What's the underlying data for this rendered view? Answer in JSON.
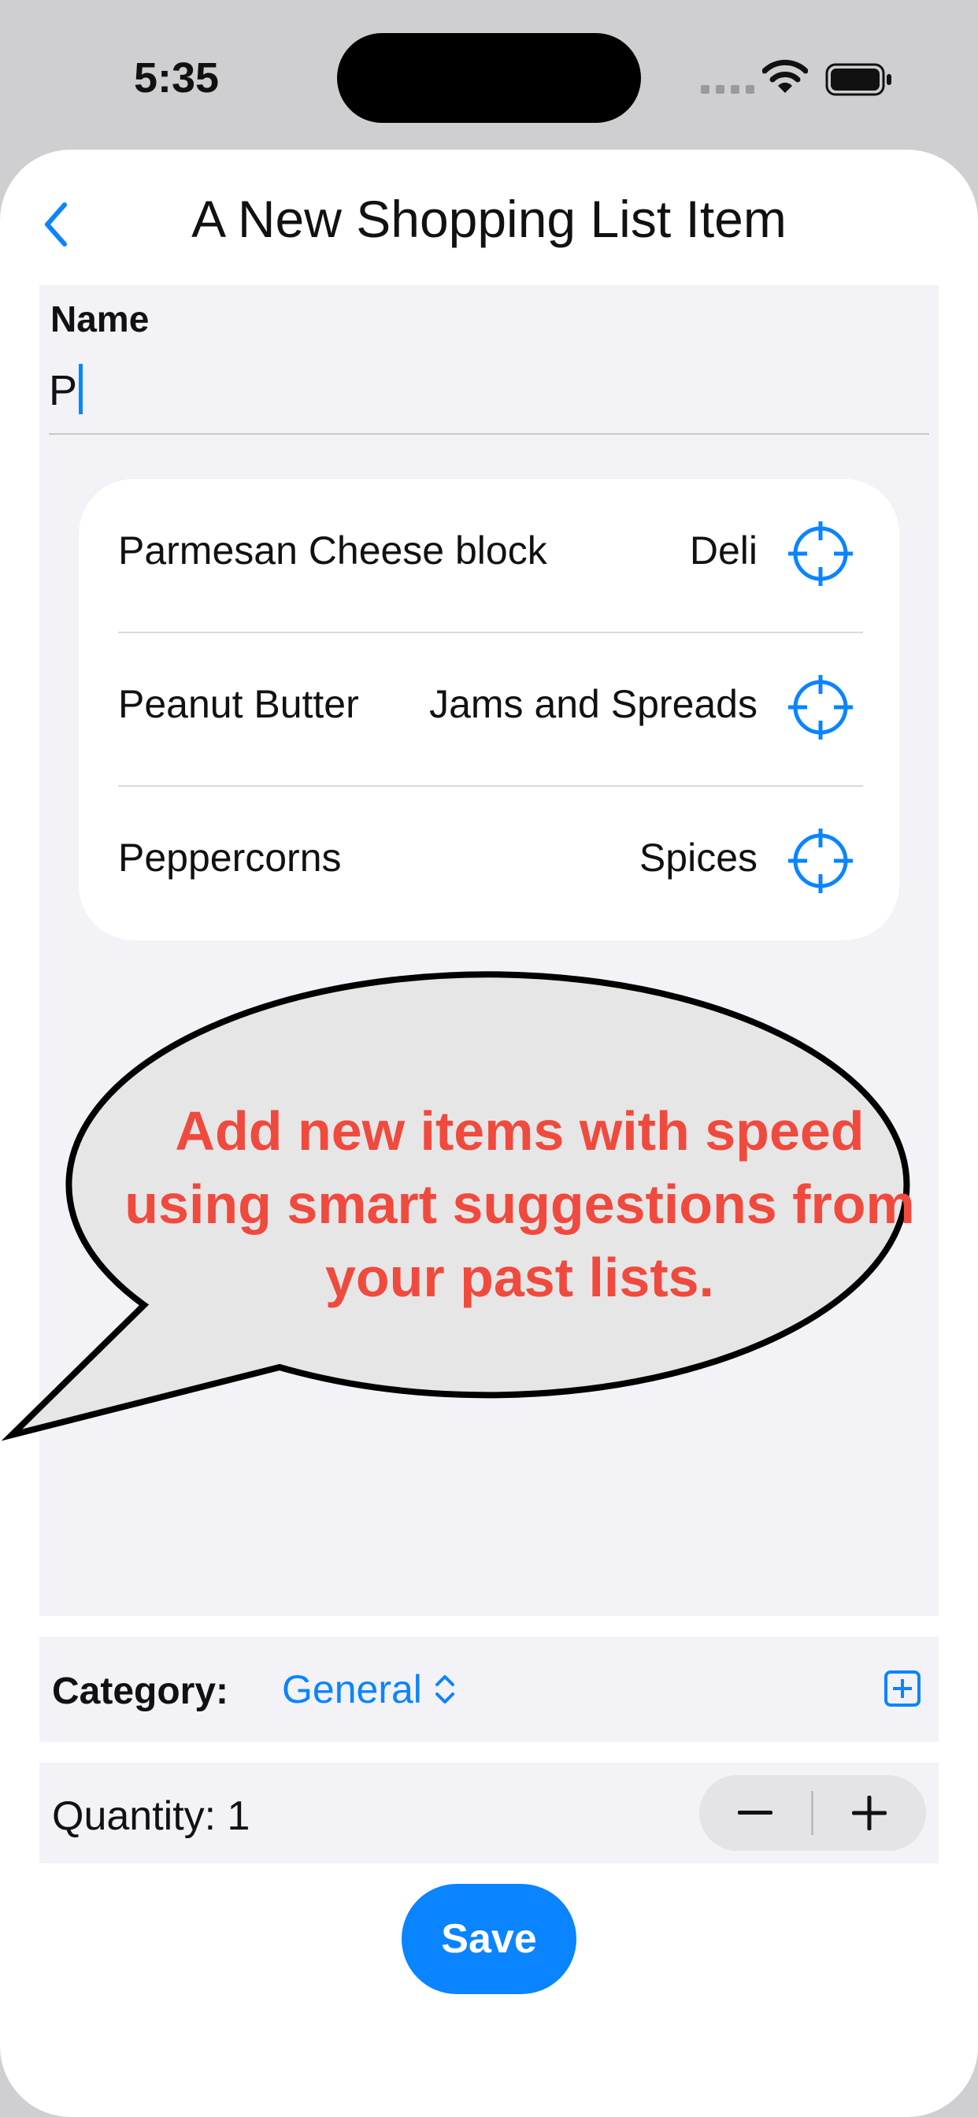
{
  "status_bar": {
    "time": "5:35"
  },
  "nav": {
    "title": "A New Shopping List Item"
  },
  "name_field": {
    "label": "Name",
    "value": "P"
  },
  "suggestions": [
    {
      "name": "Parmesan Cheese block",
      "category": "Deli"
    },
    {
      "name": "Peanut Butter",
      "category": "Jams and Spreads"
    },
    {
      "name": "Peppercorns",
      "category": "Spices"
    }
  ],
  "callout": {
    "text": "Add new items with speed using smart suggestions from your past lists."
  },
  "category": {
    "label": "Category:",
    "value": "General"
  },
  "quantity": {
    "label": "Quantity: 1"
  },
  "save_button": {
    "label": "Save"
  },
  "colors": {
    "accent": "#0a84ff",
    "callout_text": "#f04a3e",
    "callout_fill": "#e6e6e6"
  }
}
